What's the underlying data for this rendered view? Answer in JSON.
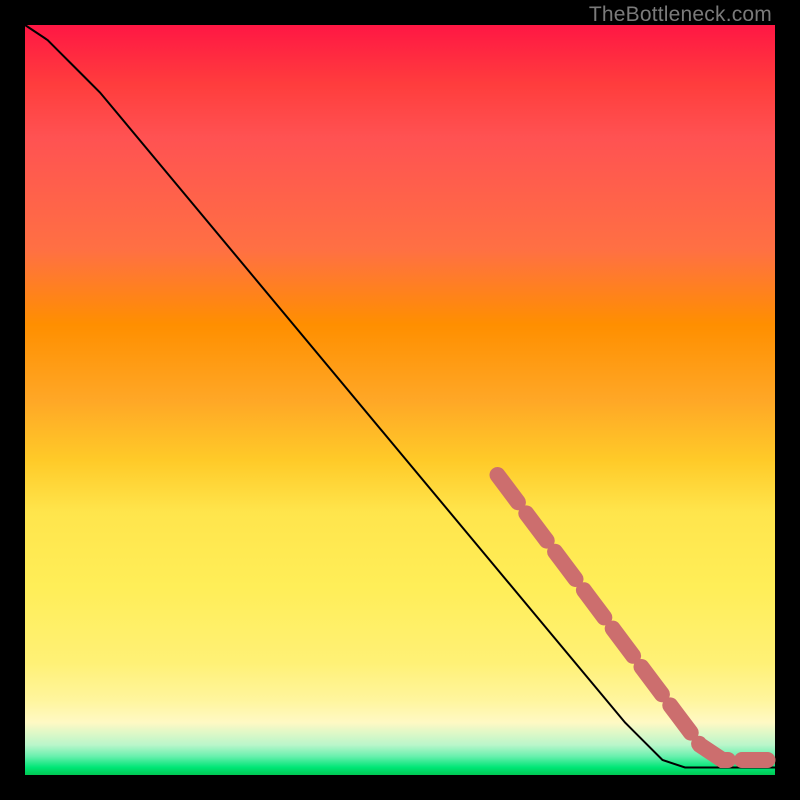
{
  "watermark": "TheBottleneck.com",
  "chart_data": {
    "type": "line",
    "title": "",
    "xlabel": "",
    "ylabel": "",
    "xlim": [
      0,
      100
    ],
    "ylim": [
      0,
      100
    ],
    "grid": false,
    "legend": false,
    "series": [
      {
        "name": "bottleneck-curve",
        "style": "solid-black",
        "points": [
          {
            "x": 0,
            "y": 100
          },
          {
            "x": 3,
            "y": 98
          },
          {
            "x": 6,
            "y": 95
          },
          {
            "x": 10,
            "y": 91
          },
          {
            "x": 20,
            "y": 79
          },
          {
            "x": 30,
            "y": 67
          },
          {
            "x": 40,
            "y": 55
          },
          {
            "x": 50,
            "y": 43
          },
          {
            "x": 60,
            "y": 31
          },
          {
            "x": 70,
            "y": 19
          },
          {
            "x": 80,
            "y": 7
          },
          {
            "x": 85,
            "y": 2
          },
          {
            "x": 88,
            "y": 1
          },
          {
            "x": 92,
            "y": 1
          },
          {
            "x": 96,
            "y": 1
          },
          {
            "x": 100,
            "y": 1
          }
        ]
      },
      {
        "name": "highlight-band",
        "style": "thick-salmon-dashed",
        "color": "#cc6e6e",
        "points": [
          {
            "x": 63,
            "y": 40
          },
          {
            "x": 66,
            "y": 36
          },
          {
            "x": 69,
            "y": 32
          },
          {
            "x": 72,
            "y": 28
          },
          {
            "x": 75,
            "y": 24
          },
          {
            "x": 78,
            "y": 20
          },
          {
            "x": 81,
            "y": 16
          },
          {
            "x": 84,
            "y": 12
          },
          {
            "x": 87,
            "y": 8
          },
          {
            "x": 90,
            "y": 4
          },
          {
            "x": 93,
            "y": 2
          },
          {
            "x": 96,
            "y": 2
          },
          {
            "x": 99,
            "y": 2
          }
        ]
      }
    ]
  }
}
